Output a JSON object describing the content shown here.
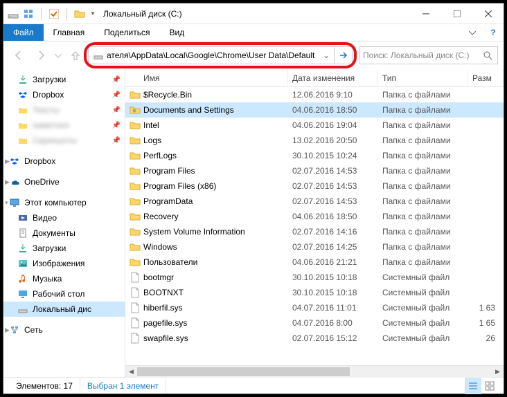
{
  "title": "Локальный диск (C:)",
  "ribbon": {
    "file": "Файл",
    "home": "Главная",
    "share": "Поделиться",
    "view": "Вид"
  },
  "address": "ателя\\AppData\\Local\\Google\\Chrome\\User Data\\Default",
  "search_placeholder": "Поиск: Локальный диск (C:)",
  "columns": {
    "name": "Имя",
    "date": "Дата изменения",
    "type": "Тип",
    "size": "Разм"
  },
  "sidebar": {
    "downloads": "Загрузки",
    "dropbox1": "Dropbox",
    "blur1": "Тексты",
    "blur2": "наметоон",
    "blur3": "Скриншоты",
    "dropbox2": "Dropbox",
    "onedrive": "OneDrive",
    "thispc": "Этот компьютер",
    "video": "Видео",
    "documents": "Документы",
    "downloads2": "Загрузки",
    "pictures": "Изображения",
    "music": "Музыка",
    "desktop": "Рабочий стол",
    "localdisk": "Локальный дис",
    "network": "Сеть"
  },
  "rows": [
    {
      "name": "$Recycle.Bin",
      "date": "12.06.2016 9:10",
      "type": "Папка с файлами",
      "size": "",
      "icon": "folder"
    },
    {
      "name": "Documents and Settings",
      "date": "04.06.2016 18:50",
      "type": "Папка с файлами",
      "size": "",
      "icon": "folder-short",
      "sel": true
    },
    {
      "name": "Intel",
      "date": "04.06.2016 19:04",
      "type": "Папка с файлами",
      "size": "",
      "icon": "folder"
    },
    {
      "name": "Logs",
      "date": "13.02.2016 20:50",
      "type": "Папка с файлами",
      "size": "",
      "icon": "folder"
    },
    {
      "name": "PerfLogs",
      "date": "30.10.2015 10:24",
      "type": "Папка с файлами",
      "size": "",
      "icon": "folder"
    },
    {
      "name": "Program Files",
      "date": "02.07.2016 14:53",
      "type": "Папка с файлами",
      "size": "",
      "icon": "folder"
    },
    {
      "name": "Program Files (x86)",
      "date": "02.07.2016 14:53",
      "type": "Папка с файлами",
      "size": "",
      "icon": "folder"
    },
    {
      "name": "ProgramData",
      "date": "02.07.2016 14:53",
      "type": "Папка с файлами",
      "size": "",
      "icon": "folder"
    },
    {
      "name": "Recovery",
      "date": "04.06.2016 18:50",
      "type": "Папка с файлами",
      "size": "",
      "icon": "folder"
    },
    {
      "name": "System Volume Information",
      "date": "02.07.2016 14:16",
      "type": "Папка с файлами",
      "size": "",
      "icon": "folder"
    },
    {
      "name": "Windows",
      "date": "02.07.2016 14:25",
      "type": "Папка с файлами",
      "size": "",
      "icon": "folder"
    },
    {
      "name": "Пользователи",
      "date": "04.06.2016 21:21",
      "type": "Папка с файлами",
      "size": "",
      "icon": "folder"
    },
    {
      "name": "bootmgr",
      "date": "30.10.2015 10:18",
      "type": "Системный файл",
      "size": "",
      "icon": "file"
    },
    {
      "name": "BOOTNXT",
      "date": "30.10.2015 10:18",
      "type": "Системный файл",
      "size": "",
      "icon": "file"
    },
    {
      "name": "hiberfil.sys",
      "date": "04.07.2016 11:01",
      "type": "Системный файл",
      "size": "1 63",
      "icon": "file"
    },
    {
      "name": "pagefile.sys",
      "date": "04.07.2016 8:00",
      "type": "Системный файл",
      "size": "1 65",
      "icon": "file"
    },
    {
      "name": "swapfile.sys",
      "date": "02.07.2016 15:12",
      "type": "Системный файл",
      "size": "26",
      "icon": "file"
    }
  ],
  "status": {
    "count_label": "Элементов:",
    "count": "17",
    "selected": "Выбран 1 элемент"
  }
}
